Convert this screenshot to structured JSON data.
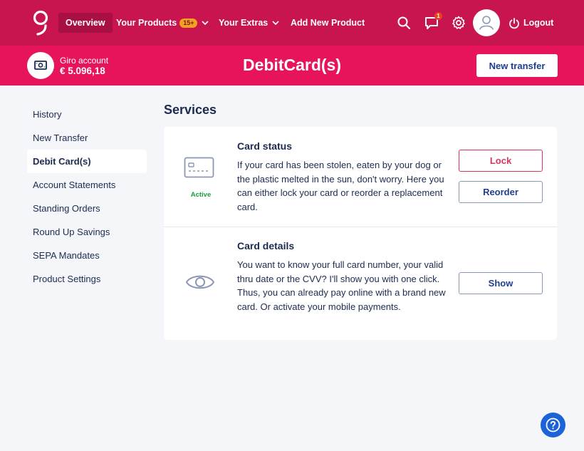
{
  "nav": {
    "overview": "Overview",
    "your_products": "Your Products",
    "products_badge": "15+",
    "your_extras": "Your Extras",
    "add_new_product": "Add New Product",
    "messages_badge": "1",
    "logout": "Logout"
  },
  "account": {
    "name": "Giro account",
    "balance": "€ 5.096,18"
  },
  "page_title": "DebitCard(s)",
  "new_transfer_label": "New transfer",
  "sidebar": {
    "items": [
      {
        "label": "History"
      },
      {
        "label": "New Transfer"
      },
      {
        "label": "Debit Card(s)",
        "active": true
      },
      {
        "label": "Account Statements"
      },
      {
        "label": "Standing Orders"
      },
      {
        "label": "Round Up Savings"
      },
      {
        "label": "SEPA Mandates"
      },
      {
        "label": "Product Settings"
      }
    ]
  },
  "services": {
    "title": "Services",
    "card_status": {
      "title": "Card status",
      "status": "Active",
      "text": "If your card has been stolen, eaten by your dog or the plastic melted in the sun, don't worry. Here you can either lock your card or reorder a replacement card.",
      "lock_label": "Lock",
      "reorder_label": "Reorder"
    },
    "card_details": {
      "title": "Card details",
      "text": "You want to know your full card number, your valid thru date or the CVV? I'll show you with one click. Thus, you can already pay online with a brand new card. Or activate your mobile payments.",
      "show_label": "Show"
    }
  },
  "colors": {
    "nav_bg": "#c8154f",
    "account_bar_bg": "#e7135b",
    "primary_text": "#1d2b4f",
    "button_text": "#1d3f8f",
    "lock_red": "#d9345c",
    "active_green": "#1e9e3c",
    "help_blue": "#1d63d8"
  }
}
